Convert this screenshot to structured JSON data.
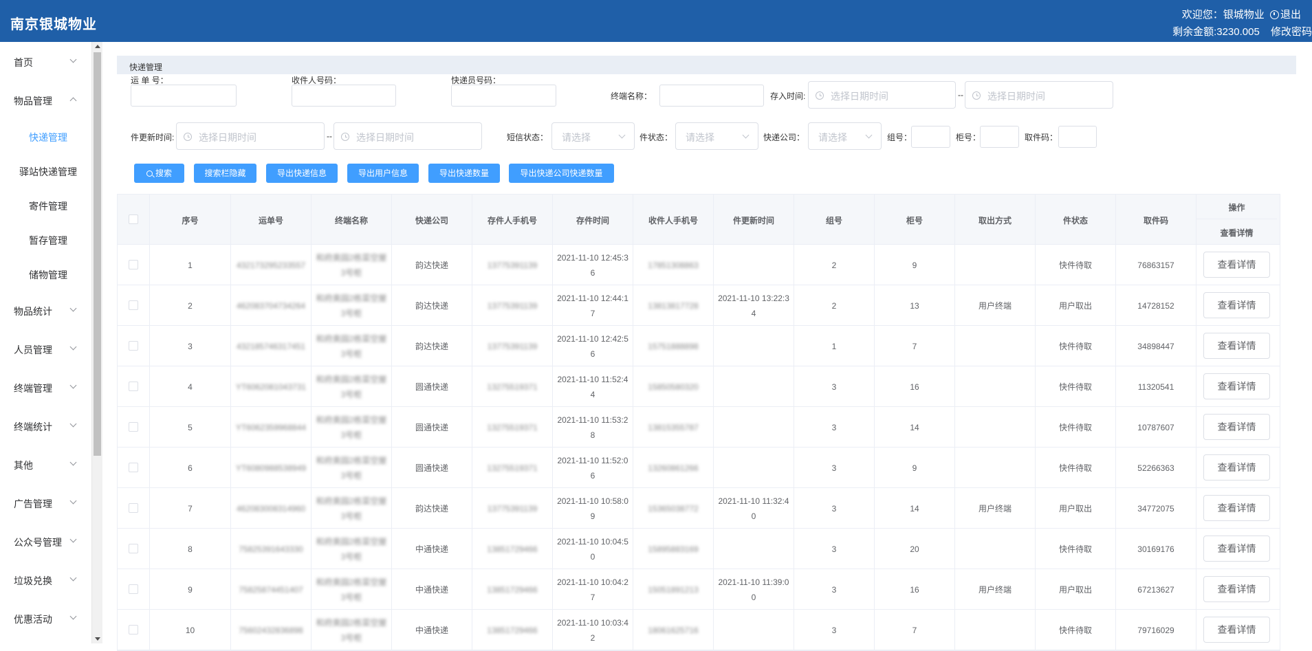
{
  "header": {
    "brand": "南京银城物业",
    "welcome": "欢迎您：银城物业",
    "logout": "退出",
    "balance": "剩余金额:3230.005",
    "change_password": "修改密码"
  },
  "sidebar": {
    "items": [
      {
        "label": "首页"
      },
      {
        "label": "物品管理"
      },
      {
        "label": "物品统计"
      },
      {
        "label": "人员管理"
      },
      {
        "label": "终端管理"
      },
      {
        "label": "终端统计"
      },
      {
        "label": "其他"
      },
      {
        "label": "广告管理"
      },
      {
        "label": "公众号管理"
      },
      {
        "label": "垃圾兑换"
      },
      {
        "label": "优惠活动"
      }
    ],
    "subitems": [
      {
        "label": "快递管理"
      },
      {
        "label": "驿站快递管理"
      },
      {
        "label": "寄件管理"
      },
      {
        "label": "暂存管理"
      },
      {
        "label": "储物管理"
      }
    ]
  },
  "section_title": "快递管理",
  "filters": {
    "waybill": "运 单 号：",
    "receiver_phone": "收件人号码：",
    "courier_phone": "快递员号码：",
    "terminal": "终端名称：",
    "store_time": "存入时间:",
    "update_time": "件更新时间:",
    "date_placeholder": "选择日期时间",
    "dash": "--",
    "sms_status": "短信状态：",
    "item_status": "件状态：",
    "express_company": "快递公司：",
    "select_placeholder": "请选择",
    "group": "组号：",
    "cabinet": "柜号：",
    "pickup_code": "取件码："
  },
  "buttons": {
    "search": "搜索",
    "hide_search": "搜索栏隐藏",
    "export_express": "导出快递信息",
    "export_user": "导出用户信息",
    "export_count": "导出快递数量",
    "export_company_count": "导出快递公司快递数量"
  },
  "table": {
    "columns": [
      "序号",
      "运单号",
      "终端名称",
      "快递公司",
      "存件人手机号",
      "存件时间",
      "收件人手机号",
      "件更新时间",
      "组号",
      "柜号",
      "取出方式",
      "件状态",
      "取件码"
    ],
    "op_header": "操作",
    "op_subheader": "查看详情",
    "detail_label": "查看详情",
    "rows": [
      {
        "no": "1",
        "waybill": "432173295233557",
        "terminal": "和府奥园2栋菜空屋3号柜",
        "company": "韵达快递",
        "sender": "13775391139",
        "store": "2021-11-10 12:45:36",
        "receiver": "17851308863",
        "update": "",
        "group": "2",
        "cabinet": "9",
        "method": "",
        "status": "快件待取",
        "code": "76863157"
      },
      {
        "no": "2",
        "waybill": "462083704734264",
        "terminal": "和府奥园2栋菜空屋3号柜",
        "company": "韵达快递",
        "sender": "13775391139",
        "store": "2021-11-10 12:44:17",
        "receiver": "13813817728",
        "update": "2021-11-10 13:22:34",
        "group": "2",
        "cabinet": "13",
        "method": "用户终端",
        "status": "用户取出",
        "code": "14728152"
      },
      {
        "no": "3",
        "waybill": "432185746317451",
        "terminal": "和府奥园2栋菜空屋3号柜",
        "company": "韵达快递",
        "sender": "13775391139",
        "store": "2021-11-10 12:42:56",
        "receiver": "15751888898",
        "update": "",
        "group": "1",
        "cabinet": "7",
        "method": "",
        "status": "快件待取",
        "code": "34898447"
      },
      {
        "no": "4",
        "waybill": "YT6062081043731",
        "terminal": "和府奥园2栋菜空屋3号柜",
        "company": "圆通快递",
        "sender": "13275519371",
        "store": "2021-11-10 11:52:44",
        "receiver": "15850580320",
        "update": "",
        "group": "3",
        "cabinet": "16",
        "method": "",
        "status": "快件待取",
        "code": "11320541"
      },
      {
        "no": "5",
        "waybill": "YT6062359968844",
        "terminal": "和府奥园2栋菜空屋3号柜",
        "company": "圆通快递",
        "sender": "13275519371",
        "store": "2021-11-10 11:53:28",
        "receiver": "13815355787",
        "update": "",
        "group": "3",
        "cabinet": "14",
        "method": "",
        "status": "快件待取",
        "code": "10787607"
      },
      {
        "no": "6",
        "waybill": "YT6080988538949",
        "terminal": "和府奥园2栋菜空屋3号柜",
        "company": "圆通快递",
        "sender": "13275519371",
        "store": "2021-11-10 11:52:06",
        "receiver": "13260861266",
        "update": "",
        "group": "3",
        "cabinet": "9",
        "method": "",
        "status": "快件待取",
        "code": "52266363"
      },
      {
        "no": "7",
        "waybill": "462083008314960",
        "terminal": "和府奥园2栋菜空屋3号柜",
        "company": "韵达快递",
        "sender": "13775391139",
        "store": "2021-11-10 10:58:09",
        "receiver": "15365038772",
        "update": "2021-11-10 11:32:40",
        "group": "3",
        "cabinet": "14",
        "method": "用户终端",
        "status": "用户取出",
        "code": "34772075"
      },
      {
        "no": "8",
        "waybill": "75825391643330",
        "terminal": "和府奥园2栋菜空屋3号柜",
        "company": "中通快递",
        "sender": "13851729466",
        "store": "2021-11-10 10:04:50",
        "receiver": "15895883169",
        "update": "",
        "group": "3",
        "cabinet": "20",
        "method": "",
        "status": "快件待取",
        "code": "30169176"
      },
      {
        "no": "9",
        "waybill": "75825874451407",
        "terminal": "和府奥园2栋菜空屋3号柜",
        "company": "中通快递",
        "sender": "13851729466",
        "store": "2021-11-10 10:04:27",
        "receiver": "15051891213",
        "update": "2021-11-10 11:39:00",
        "group": "3",
        "cabinet": "16",
        "method": "用户终端",
        "status": "用户取出",
        "code": "67213627"
      },
      {
        "no": "10",
        "waybill": "75602432836898",
        "terminal": "和府奥园2栋菜空屋3号柜",
        "company": "中通快递",
        "sender": "13851729466",
        "store": "2021-11-10 10:03:42",
        "receiver": "18061625716",
        "update": "",
        "group": "3",
        "cabinet": "7",
        "method": "",
        "status": "快件待取",
        "code": "79716029"
      }
    ]
  }
}
